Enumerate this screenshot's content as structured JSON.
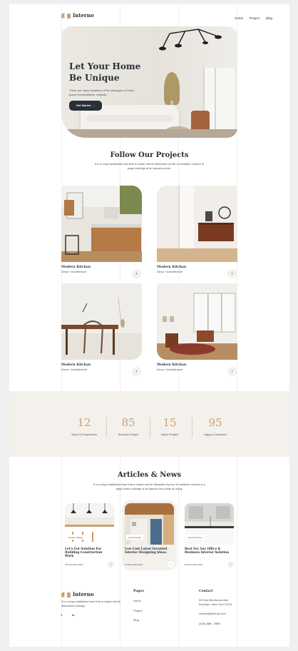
{
  "brand": {
    "name": "Interno"
  },
  "nav": [
    "Home",
    "Project",
    "Blog"
  ],
  "hero": {
    "title": "Let Your Home Be Unique",
    "text": "There are many variations of the passages of lorem Ipsum fromavailable, majority.",
    "cta": "Get Started"
  },
  "projects": {
    "title": "Follow Our Projects",
    "subtitle": "It is a long established fact that a reader will be distracted by the of readable content of page lookings at its layouts points.",
    "items": [
      {
        "name": "Modern Kitchan",
        "category": "Decor / Architecture"
      },
      {
        "name": "Modern Kitchan",
        "category": "Decor / Artchitecture"
      },
      {
        "name": "Modern Kitchan",
        "category": "Decor / Artchitecture"
      },
      {
        "name": "Modern Kitchan",
        "category": "Decor / Artchitecture"
      }
    ]
  },
  "stats": [
    {
      "value": "12",
      "label": "Years Of Experiance"
    },
    {
      "value": "85",
      "label": "Success Project"
    },
    {
      "value": "15",
      "label": "Active Project"
    },
    {
      "value": "95",
      "label": "Happy Customers"
    }
  ],
  "articles": {
    "title": "Articles & News",
    "subtitle": "It is a long established fact that a reader will be distracted by the of readable content of a page when lookings at its layouts the points of using.",
    "items": [
      {
        "tag": "Kitchan Design",
        "title": "Let's Get Solution For Building Construction Work",
        "date": "26 December,2022"
      },
      {
        "tag": "Living Design",
        "title": "Low Cost Latest Invented Interior Designing Ideas.",
        "date": "22 December,2022"
      },
      {
        "tag": "Interior Design",
        "title": "Best For Any Office & Business Interior Solution",
        "date": "25 December,2022"
      }
    ]
  },
  "footer": {
    "about": "It is a long established fact that a reader will be distracted lookings.",
    "social": [
      "f",
      "in"
    ],
    "pages_title": "Pages",
    "pages": [
      "Home",
      "Project",
      "Blog"
    ],
    "contact_title": "Contact",
    "address": "55 East Birchwood Ave. Brooklyn, New York 11201",
    "email": "contact@interno.com",
    "phone": "(123) 456 - 7890"
  },
  "colors": {
    "accent": "#cda274",
    "dark": "#292f36",
    "cream": "#f4f0ec"
  }
}
